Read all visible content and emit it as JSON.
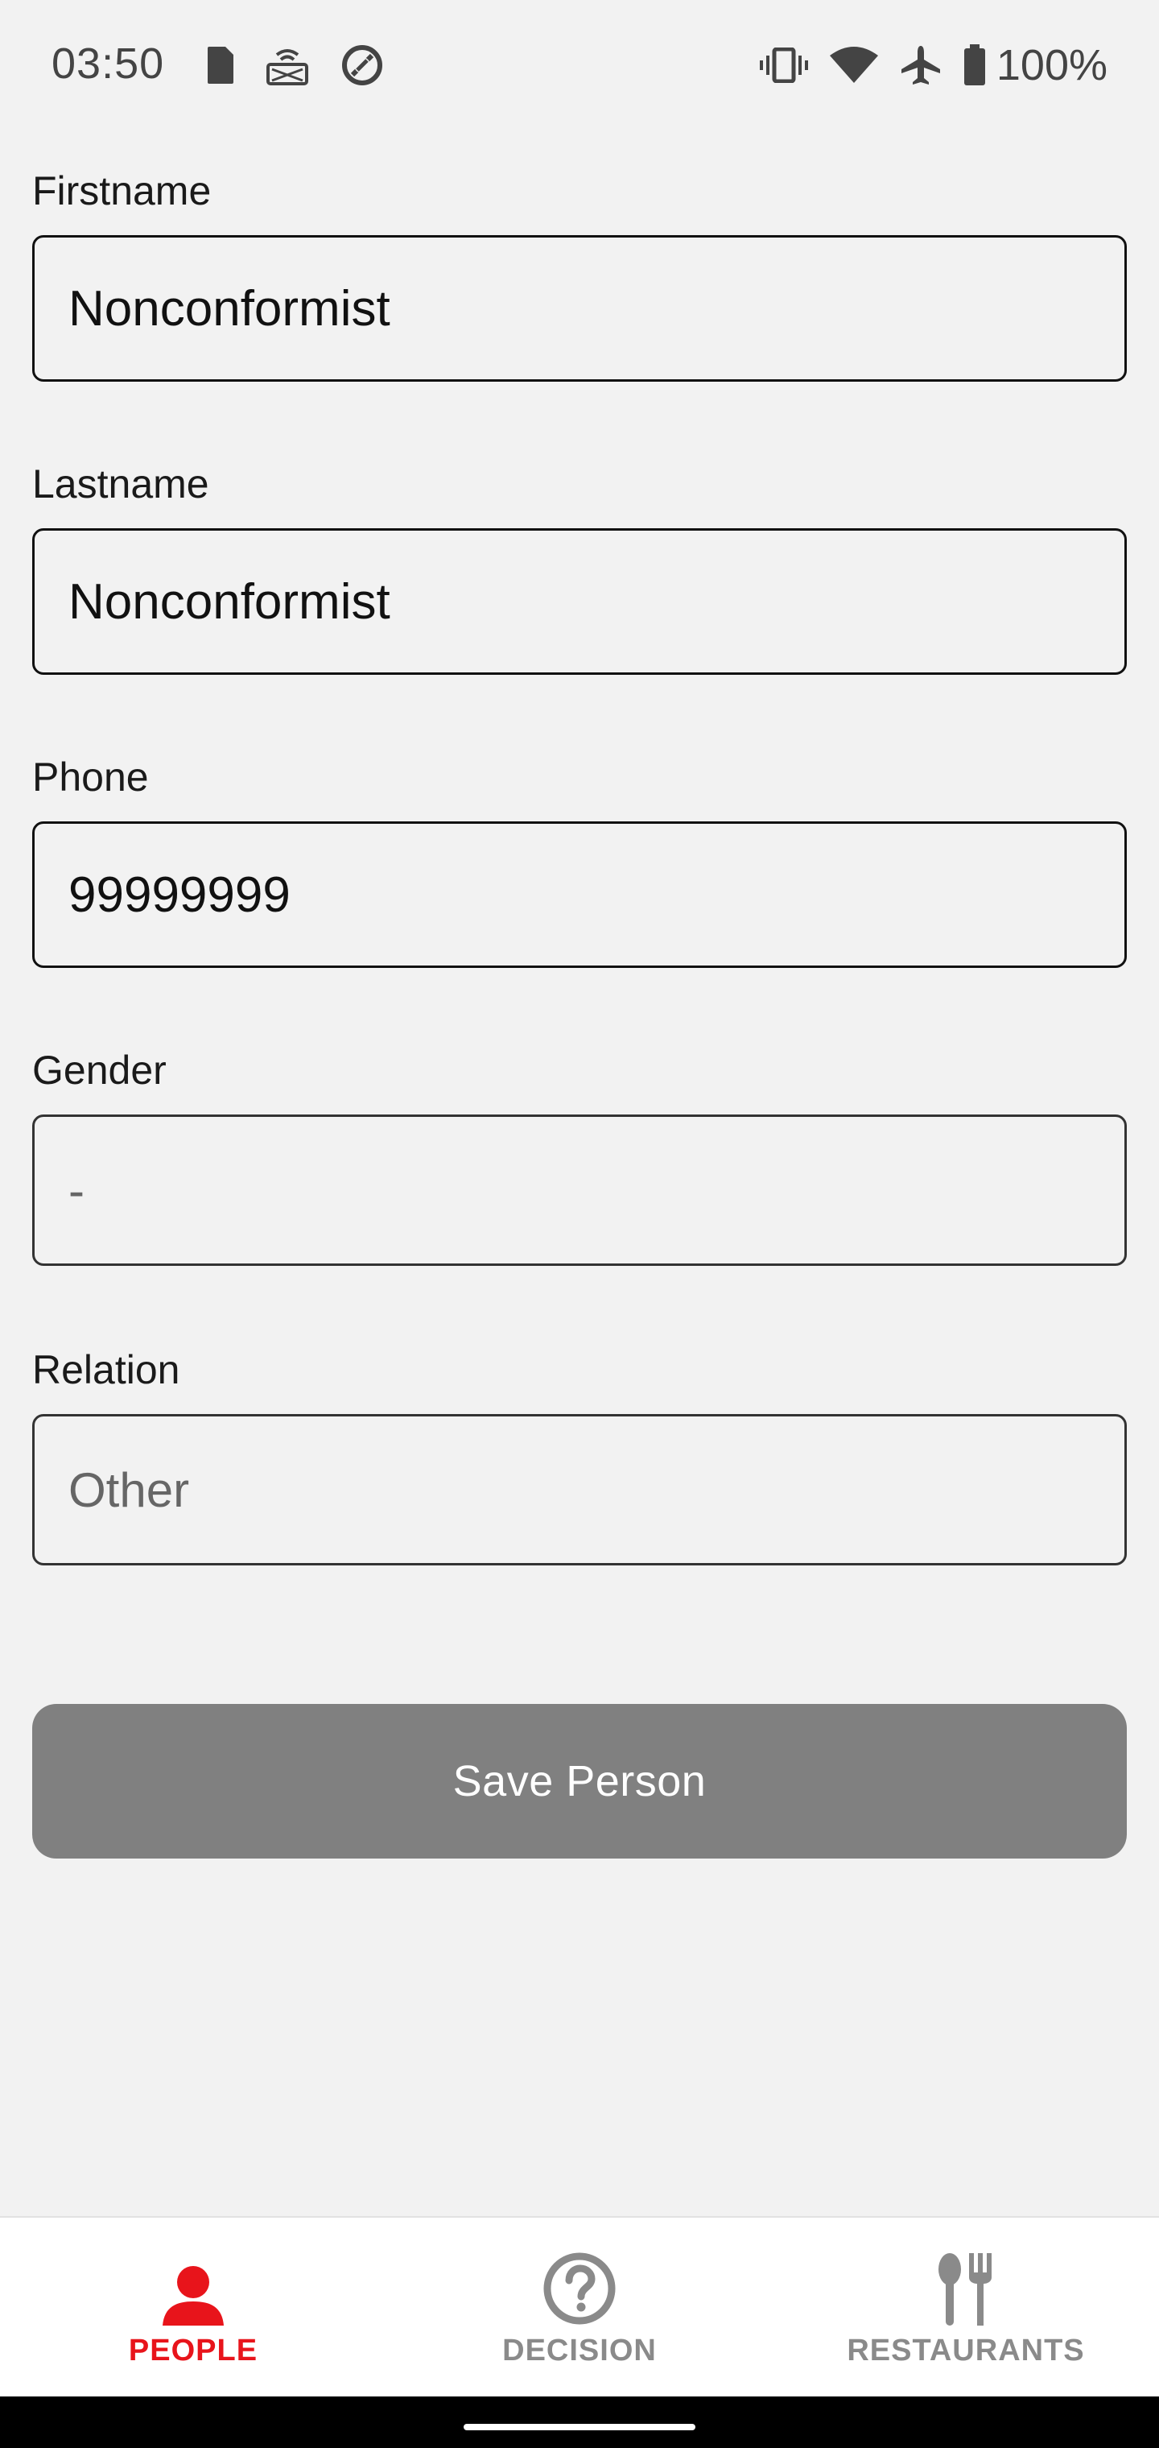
{
  "status_bar": {
    "time": "03:50",
    "battery_percent": "100%",
    "left_icons": [
      "sim-card-icon",
      "nfc-screen-icon",
      "data-saver-icon"
    ],
    "right_icons": [
      "vibrate-icon",
      "wifi-icon",
      "airplane-icon",
      "battery-icon"
    ]
  },
  "form": {
    "firstname": {
      "label": "Firstname",
      "value": "Nonconformist"
    },
    "lastname": {
      "label": "Lastname",
      "value": "Nonconformist"
    },
    "phone": {
      "label": "Phone",
      "value": "99999999"
    },
    "gender": {
      "label": "Gender",
      "value": "-"
    },
    "relation": {
      "label": "Relation",
      "value": "Other"
    }
  },
  "save_button": {
    "label": "Save Person",
    "color": "#808080"
  },
  "bottom_nav": {
    "items": [
      {
        "label": "PEOPLE",
        "icon": "person-icon",
        "active": true
      },
      {
        "label": "DECISION",
        "icon": "question-circle-icon",
        "active": false
      },
      {
        "label": "RESTAURANTS",
        "icon": "utensils-icon",
        "active": false
      }
    ],
    "active_color": "#e8141b",
    "inactive_color": "#8a8a8a"
  }
}
